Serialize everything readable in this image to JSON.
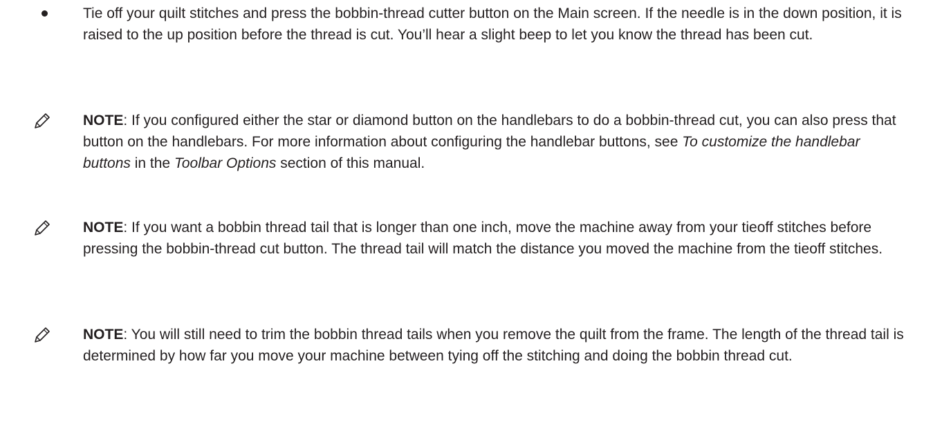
{
  "bullet": {
    "text": "Tie off your quilt stitches and press the bobbin-thread cutter button on the Main screen. If the needle is in the down position, it is raised to the up position before the thread is cut. You’ll hear a slight beep to let you know the thread has been cut."
  },
  "notes": [
    {
      "label": "NOTE",
      "text_before": ": If you configured either the star or diamond button on the handlebars to do a bobbin-thread cut, you can also press that button on the handlebars. For more information about configuring the handlebar buttons, see ",
      "ref1": "To customize the handlebar buttons",
      "text_mid": " in the ",
      "ref2": "Toolbar Options",
      "text_after": " section of this manual."
    },
    {
      "label": "NOTE",
      "text": ": If you want a bobbin thread tail that is longer than one inch, move the machine away from your tieoff stitches before pressing the bobbin-thread cut button. The thread tail will match the distance you moved the machine from the tieoff stitches."
    },
    {
      "label": "NOTE",
      "text": ": You will still need to trim the bobbin thread tails when you remove the quilt from the frame. The length of the thread tail is determined by how far you move your machine between tying off the stitching and doing the bobbin thread cut."
    }
  ],
  "icons": {
    "bullet": "bullet-dot",
    "note": "pencil-icon"
  }
}
